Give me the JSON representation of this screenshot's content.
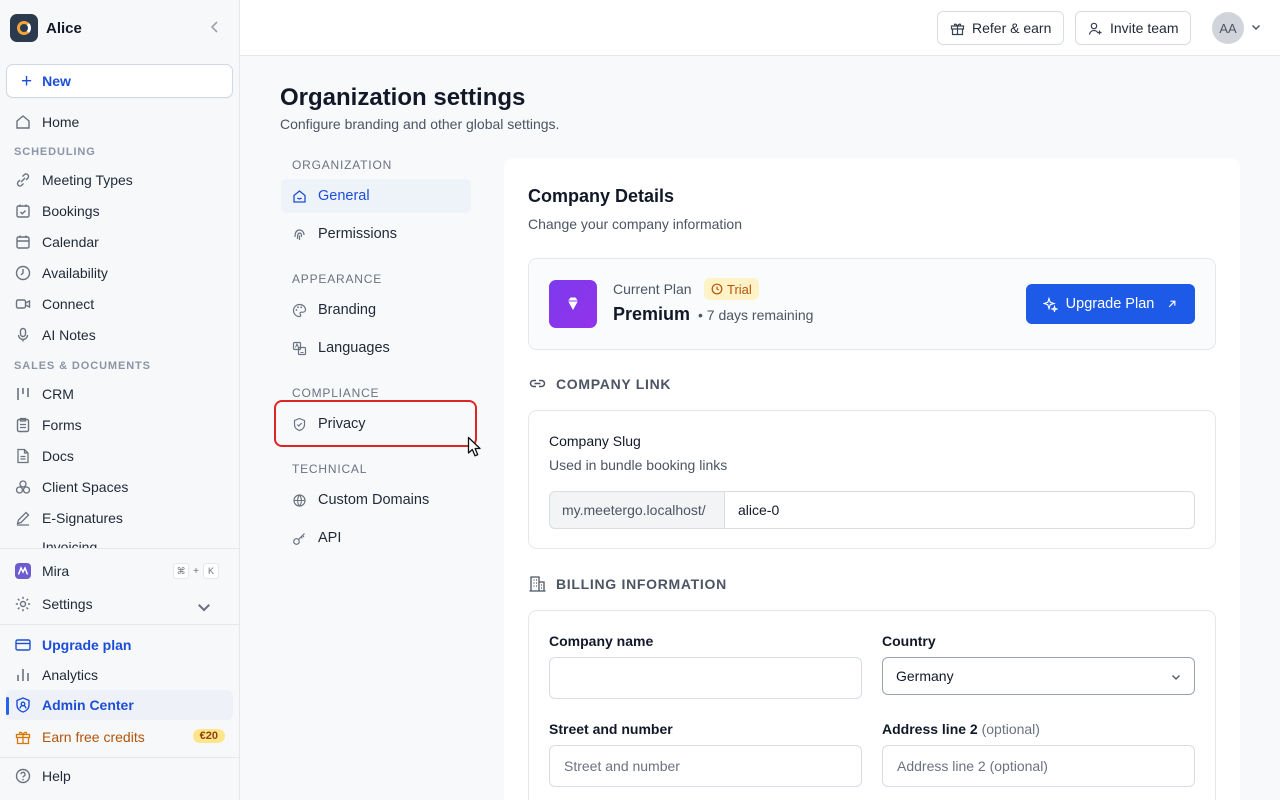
{
  "workspace": {
    "name": "Alice"
  },
  "sidebar": {
    "new_label": "New",
    "home": "Home",
    "scheduling_header": "SCHEDULING",
    "scheduling": [
      "Meeting Types",
      "Bookings",
      "Calendar",
      "Availability",
      "Connect",
      "AI Notes"
    ],
    "sales_header": "SALES & DOCUMENTS",
    "sales": [
      "CRM",
      "Forms",
      "Docs",
      "Client Spaces",
      "E-Signatures",
      "Invoicing"
    ],
    "mira": "Mira",
    "mira_shortcut": [
      "⌘",
      "+",
      "K"
    ],
    "settings": "Settings",
    "upgrade": "Upgrade plan",
    "analytics": "Analytics",
    "admin_center": "Admin Center",
    "earn_credits": "Earn free credits",
    "credit_badge": "€20",
    "help": "Help"
  },
  "topbar": {
    "refer_label": "Refer & earn",
    "invite_label": "Invite team",
    "avatar_initials": "AA"
  },
  "page": {
    "title": "Organization settings",
    "subtitle": "Configure branding and other global settings."
  },
  "settings_nav": {
    "organization_header": "ORGANIZATION",
    "general": "General",
    "permissions": "Permissions",
    "appearance_header": "APPEARANCE",
    "branding": "Branding",
    "languages": "Languages",
    "compliance_header": "COMPLIANCE",
    "privacy": "Privacy",
    "technical_header": "TECHNICAL",
    "custom_domains": "Custom Domains",
    "api": "API"
  },
  "company_details": {
    "title": "Company Details",
    "subtitle": "Change your company information",
    "plan_label": "Current Plan",
    "trial_badge": "Trial",
    "plan_name": "Premium",
    "plan_remaining": "• 7 days remaining",
    "upgrade_button": "Upgrade Plan"
  },
  "company_link": {
    "header": "COMPANY LINK",
    "slug_label": "Company Slug",
    "slug_help": "Used in bundle booking links",
    "slug_prefix": "my.meetergo.localhost/",
    "slug_value": "alice-0"
  },
  "billing": {
    "header": "BILLING INFORMATION",
    "company_name_label": "Company name",
    "company_name_value": "",
    "country_label": "Country",
    "country_value": "Germany",
    "street_label": "Street and number",
    "street_placeholder": "Street and number",
    "address2_label": "Address line 2",
    "address2_optional": "(optional)",
    "address2_placeholder": "Address line 2 (optional)"
  },
  "colors": {
    "accent": "#1d5ae8",
    "plan_icon": "#7c3aed",
    "trial_badge_bg": "#fef3c7",
    "highlight": "#dc2626",
    "credits": "#b45309"
  }
}
